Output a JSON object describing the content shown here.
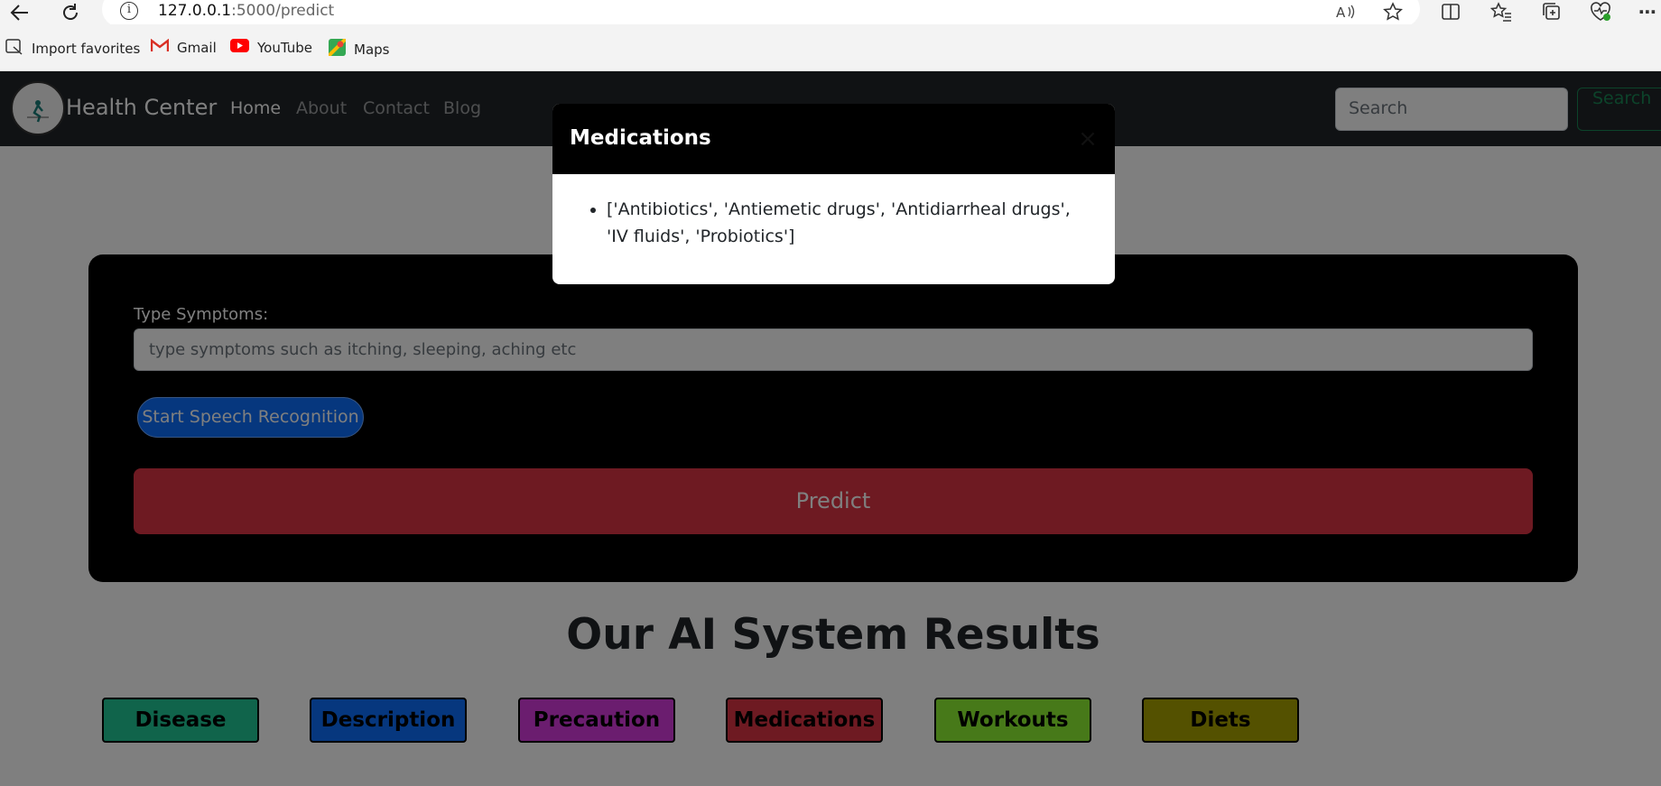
{
  "browser": {
    "url_host": "127.0.0.1",
    "url_path": ":5000/predict",
    "bookmarks": [
      {
        "label": "Import favorites",
        "icon": "import-icon"
      },
      {
        "label": "Gmail",
        "icon": "gmail-icon"
      },
      {
        "label": "YouTube",
        "icon": "youtube-icon"
      },
      {
        "label": "Maps",
        "icon": "maps-icon"
      }
    ]
  },
  "navbar": {
    "brand": "Health Center",
    "links": [
      "Home",
      "About",
      "Contact",
      "Blog"
    ],
    "search_placeholder": "Search",
    "search_button": "Search"
  },
  "form": {
    "label": "Type Symptoms:",
    "placeholder": "type symptoms such as itching, sleeping, aching etc",
    "speech_button": "Start Speech Recognition",
    "predict_button": "Predict"
  },
  "results": {
    "title": "Our AI System Results",
    "buttons": [
      {
        "label": "Disease",
        "color": "#20c997"
      },
      {
        "label": "Description",
        "color": "#0d6efd"
      },
      {
        "label": "Precaution",
        "color": "#d63adf"
      },
      {
        "label": "Medications",
        "color": "#dc3545"
      },
      {
        "label": "Workouts",
        "color": "#8ef332"
      },
      {
        "label": "Diets",
        "color": "#a8a200"
      }
    ]
  },
  "modal": {
    "title": "Medications",
    "items": [
      "['Antibiotics', 'Antiemetic drugs', 'Antidiarrheal drugs', 'IV fluids', 'Probiotics']"
    ]
  }
}
